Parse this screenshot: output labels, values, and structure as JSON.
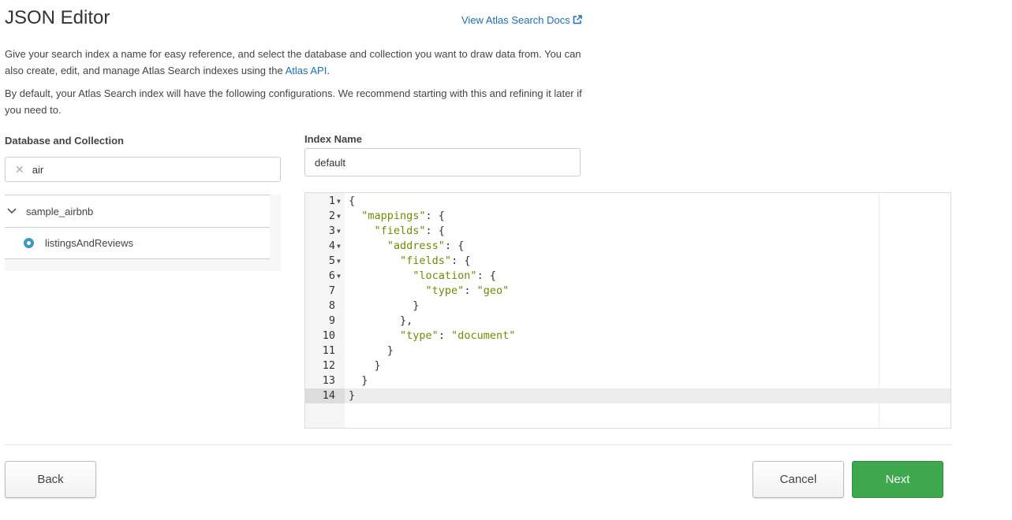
{
  "header": {
    "title": "JSON Editor",
    "docs_link": "View Atlas Search Docs",
    "docs_icon": "external-link-icon"
  },
  "description": {
    "p1_before": "Give your search index a name for easy reference, and select the database and collection you want to draw data from. You can also create, edit, and manage Atlas Search indexes using the ",
    "p1_link": "Atlas API",
    "p1_after": ".",
    "p2": "By default, your Atlas Search index will have the following configurations. We recommend starting with this and refining it later if you need to."
  },
  "db_collection": {
    "label": "Database and Collection",
    "search_value": "air",
    "database": "sample_airbnb",
    "collection": "listingsAndReviews"
  },
  "index_name": {
    "label": "Index Name",
    "value": "default"
  },
  "editor": {
    "lines": [
      "{",
      "  \"mappings\": {",
      "    \"fields\": {",
      "      \"address\": {",
      "        \"fields\": {",
      "          \"location\": {",
      "            \"type\": \"geo\"",
      "          }",
      "        },",
      "        \"type\": \"document\"",
      "      }",
      "    }",
      "  }",
      "}"
    ],
    "foldable": [
      1,
      2,
      3,
      4,
      5,
      6
    ],
    "active_line": 14
  },
  "buttons": {
    "back": "Back",
    "cancel": "Cancel",
    "next": "Next"
  },
  "colors": {
    "link": "#1a6ec1",
    "primary": "#3ea84e",
    "string": "#6b8e00",
    "radio": "#3b97c7"
  }
}
